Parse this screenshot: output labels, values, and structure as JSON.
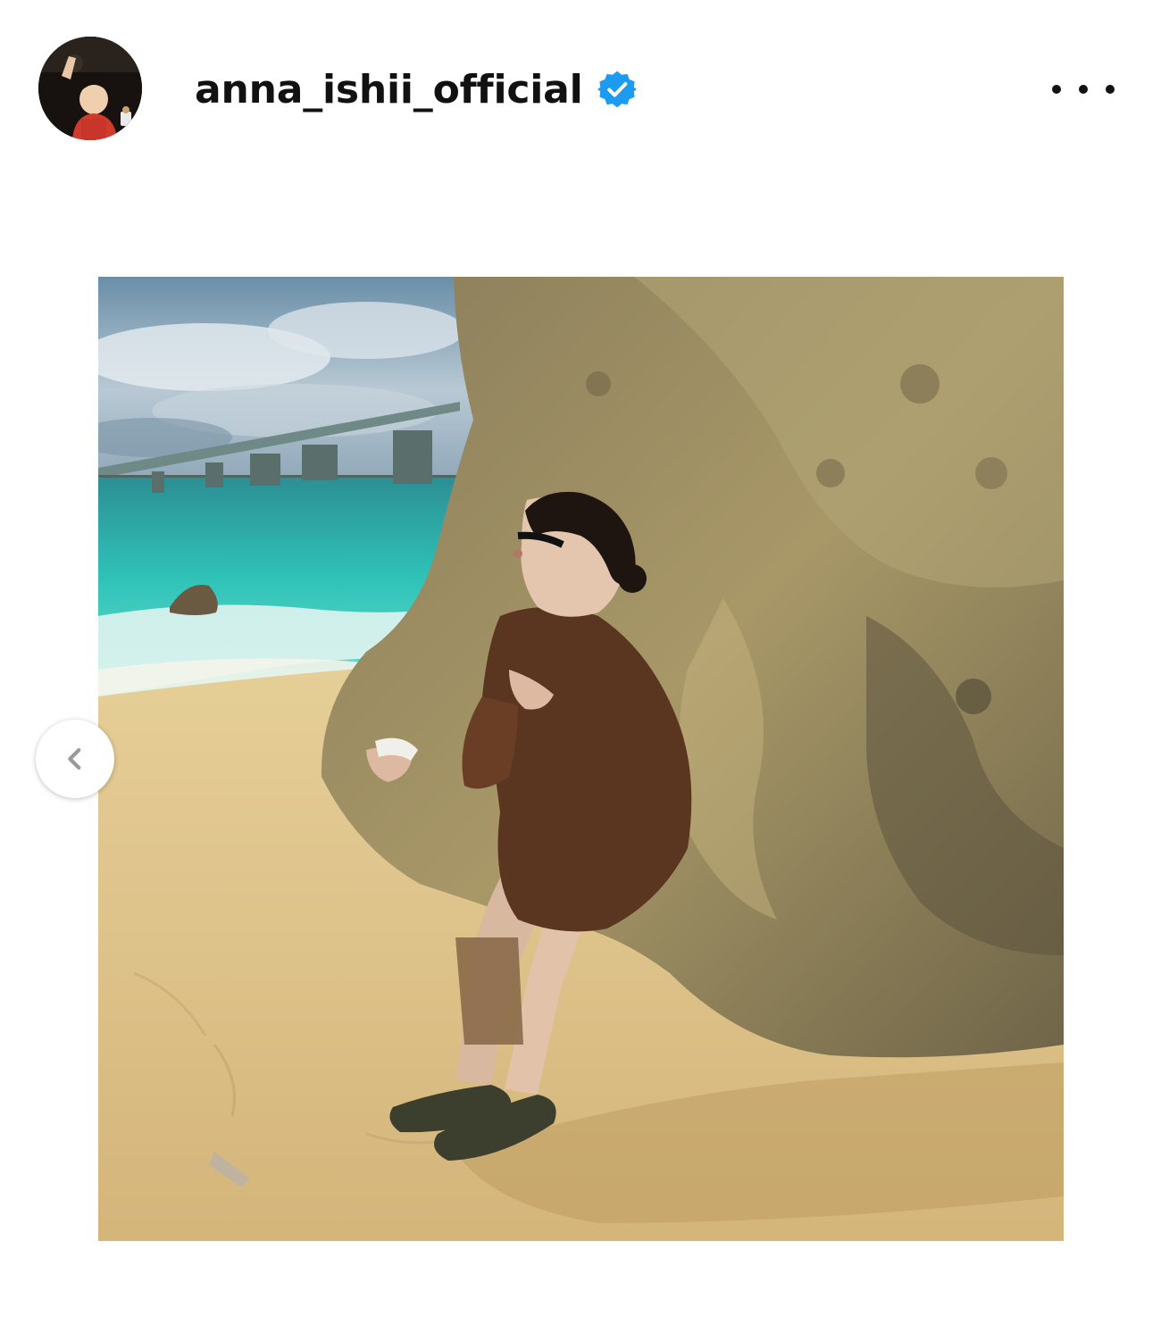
{
  "post": {
    "username": "anna_ishii_official",
    "verified": true,
    "avatar_icon": "profile-avatar",
    "verified_icon": "verified-badge-icon",
    "more_icon": "more-options-icon",
    "prev_icon": "chevron-left-icon"
  },
  "colors": {
    "verified_blue": "#1d9bf0",
    "text": "#111111",
    "background": "#ffffff"
  }
}
